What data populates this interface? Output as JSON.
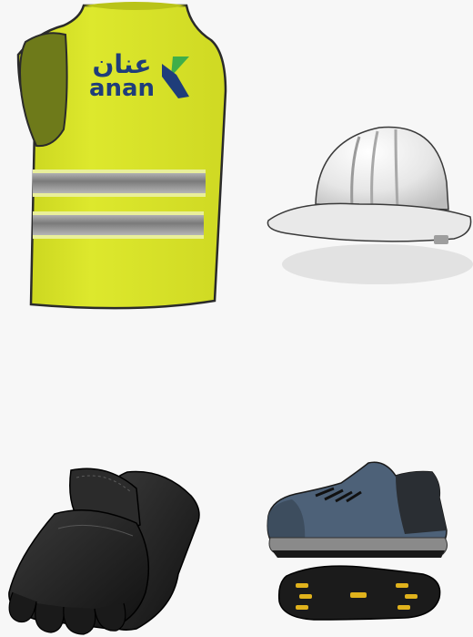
{
  "vest": {
    "brand_arabic": "عنان",
    "brand_latin": "anan",
    "color": "#dce82a",
    "logo_colors": {
      "dark": "#1f3d7a",
      "green": "#3fae49"
    }
  },
  "items": [
    "vest-icon",
    "helmet-icon",
    "gloves-icon",
    "shoes-icon"
  ]
}
